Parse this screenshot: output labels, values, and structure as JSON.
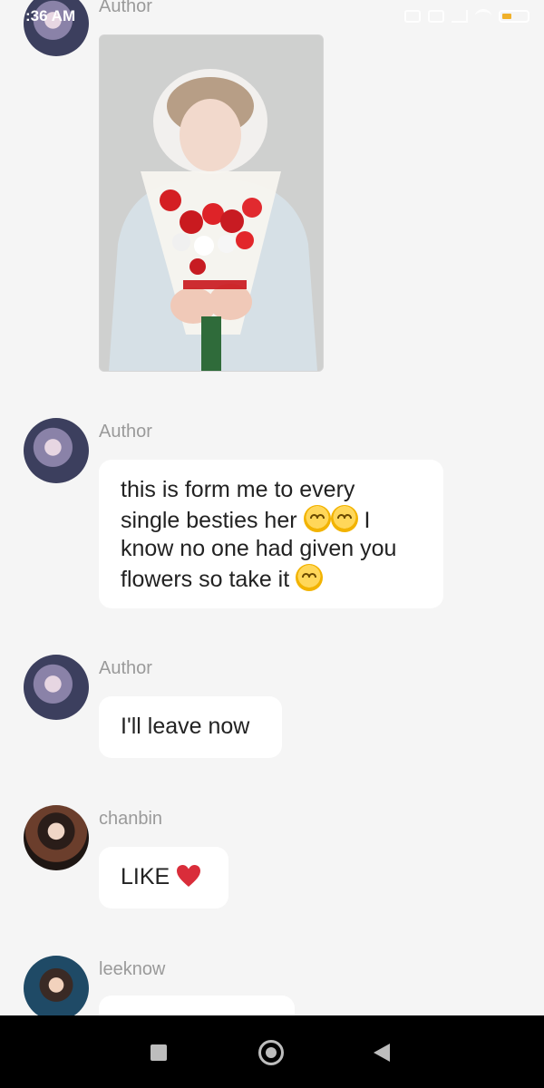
{
  "status_bar": {
    "time": ":36 AM",
    "battery_text": ""
  },
  "messages": [
    {
      "sender": "Author",
      "type": "image"
    },
    {
      "sender": "Author",
      "text_lines": [
        "this is form me to every",
        "single besties her",
        "know no one had given you",
        "flowers so take it"
      ],
      "inline_I": "I"
    },
    {
      "sender": "Author",
      "text": "I'll leave now"
    },
    {
      "sender": "chanbin",
      "text": "LIKE"
    },
    {
      "sender": "leeknow",
      "text": ""
    }
  ],
  "icons": {
    "smile": "smiling-face-icon",
    "slight_smile": "slightly-smiling-face-icon",
    "heart": "red-heart-icon"
  },
  "colors": {
    "background": "#f5f5f5",
    "bubble": "#ffffff",
    "sender": "#9a9a9a",
    "heart": "#d92d3a",
    "navbar": "#000000"
  }
}
